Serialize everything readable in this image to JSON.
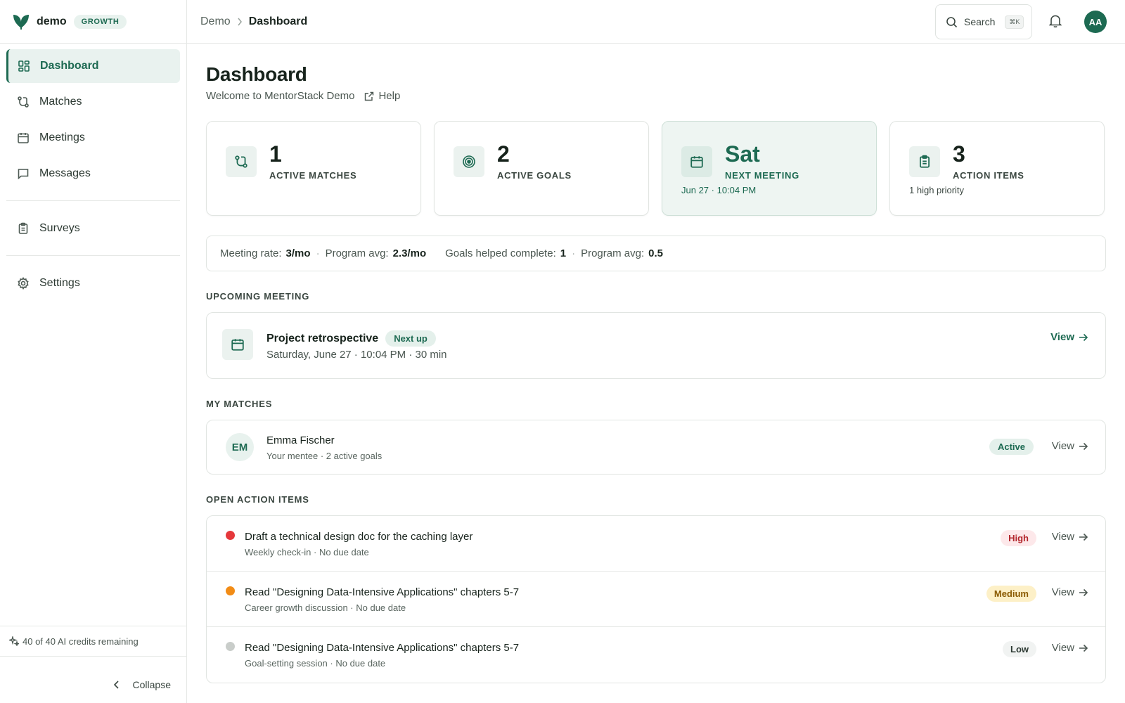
{
  "brand": {
    "name": "demo",
    "plan": "GROWTH"
  },
  "sidebar": {
    "items": [
      {
        "label": "Dashboard",
        "icon": "dashboard-grid-icon",
        "active": true
      },
      {
        "label": "Matches",
        "icon": "git-merge-icon"
      },
      {
        "label": "Meetings",
        "icon": "calendar-icon"
      },
      {
        "label": "Messages",
        "icon": "message-square-icon"
      },
      {
        "label": "Surveys",
        "icon": "clipboard-icon"
      },
      {
        "label": "Settings",
        "icon": "gear-icon"
      }
    ],
    "credits": "40 of 40 AI credits remaining",
    "collapse": "Collapse"
  },
  "header": {
    "breadcrumb": [
      "Demo",
      "Dashboard"
    ],
    "search_label": "Search",
    "search_shortcut": "⌘K",
    "avatar_initials": "AA"
  },
  "page": {
    "title": "Dashboard",
    "subtitle": "Welcome to MentorStack Demo",
    "help": "Help"
  },
  "stats": [
    {
      "value": "1",
      "label": "ACTIVE MATCHES",
      "sub": ""
    },
    {
      "value": "2",
      "label": "ACTIVE GOALS",
      "sub": ""
    },
    {
      "value": "Sat",
      "label": "NEXT MEETING",
      "sub": "Jun 27 · 10:04 PM"
    },
    {
      "value": "3",
      "label": "ACTION ITEMS",
      "sub": "1 high priority"
    }
  ],
  "rates": {
    "meeting_rate_label": "Meeting rate:",
    "meeting_rate": "3/mo",
    "program_avg_label": "Program avg:",
    "meeting_program_avg": "2.3/mo",
    "goals_label": "Goals helped complete:",
    "goals_value": "1",
    "goals_program_avg": "0.5"
  },
  "upcoming": {
    "section": "UPCOMING MEETING",
    "title": "Project retrospective",
    "badge": "Next up",
    "when": "Saturday, June 27 · 10:04 PM · 30 min",
    "view": "View"
  },
  "matches": {
    "section": "MY MATCHES",
    "initials": "EM",
    "name": "Emma Fischer",
    "sub": "Your mentee · 2 active goals",
    "status": "Active",
    "view": "View"
  },
  "actions": {
    "section": "OPEN ACTION ITEMS",
    "items": [
      {
        "title": "Draft a technical design doc for the caching layer",
        "sub": "Weekly check-in · No due date",
        "priority": "High",
        "view": "View"
      },
      {
        "title": "Read \"Designing Data-Intensive Applications\" chapters 5-7",
        "sub": "Career growth discussion · No due date",
        "priority": "Medium",
        "view": "View"
      },
      {
        "title": "Read \"Designing Data-Intensive Applications\" chapters 5-7",
        "sub": "Goal-setting session · No due date",
        "priority": "Low",
        "view": "View"
      }
    ]
  },
  "colors": {
    "brand": "#1d6a52",
    "high": "#e5383b",
    "medium": "#f28c16",
    "low": "#c9cdca"
  }
}
